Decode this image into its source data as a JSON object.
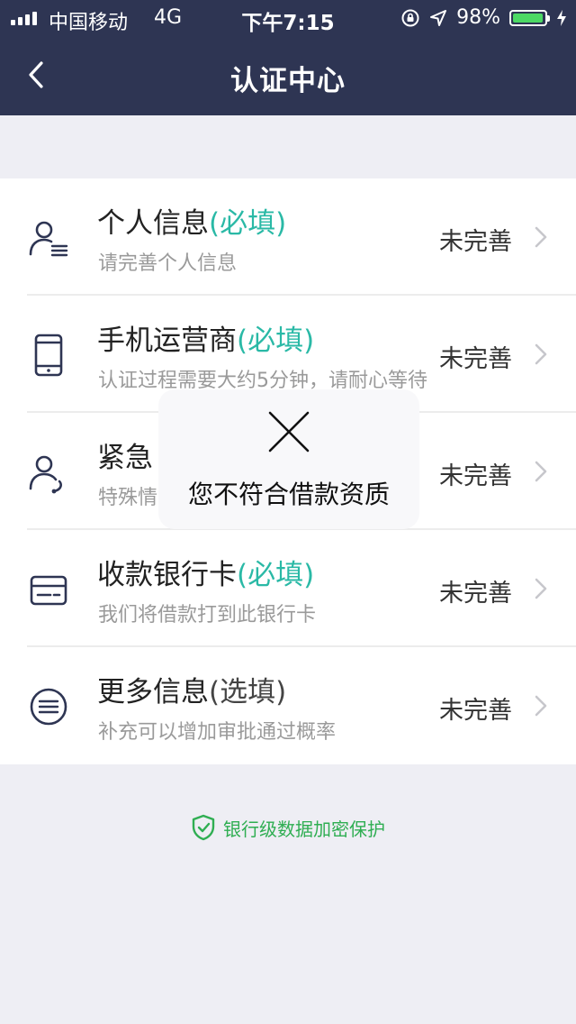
{
  "status_bar": {
    "carrier": "中国移动",
    "network": "4G",
    "time": "下午7:15",
    "battery": "98%",
    "battery_level": 0.98,
    "colors": {
      "battery_fill": "#4cd964"
    }
  },
  "nav": {
    "title": "认证中心",
    "back_icon": "chevron-left-icon"
  },
  "colors": {
    "nav_background": "#2e3553",
    "required_tag": "#2ab9a6",
    "secure_text": "#2fae52",
    "page_background": "#eeeef4"
  },
  "items": [
    {
      "title": "个人信息",
      "tag": "(必填)",
      "subtitle": "请完善个人信息",
      "status": "未完善",
      "icon": "person-info-icon"
    },
    {
      "title": "手机运营商",
      "tag": "(必填)",
      "subtitle": "认证过程需要大约5分钟，请耐心等待",
      "status": "未完善",
      "icon": "phone-icon"
    },
    {
      "title": "紧急",
      "tag": "",
      "subtitle": "特殊情",
      "status": "未完善",
      "icon": "contact-phone-icon"
    },
    {
      "title": "收款银行卡",
      "tag": "(必填)",
      "subtitle": "我们将借款打到此银行卡",
      "status": "未完善",
      "icon": "bank-card-icon"
    },
    {
      "title": "更多信息",
      "tag": "(选填)",
      "subtitle": "补充可以增加审批通过概率",
      "status": "未完善",
      "icon": "more-info-icon"
    }
  ],
  "toast": {
    "message": "您不符合借款资质",
    "icon": "close-icon"
  },
  "footer": {
    "secure_text": "银行级数据加密保护",
    "icon": "shield-check-icon"
  }
}
